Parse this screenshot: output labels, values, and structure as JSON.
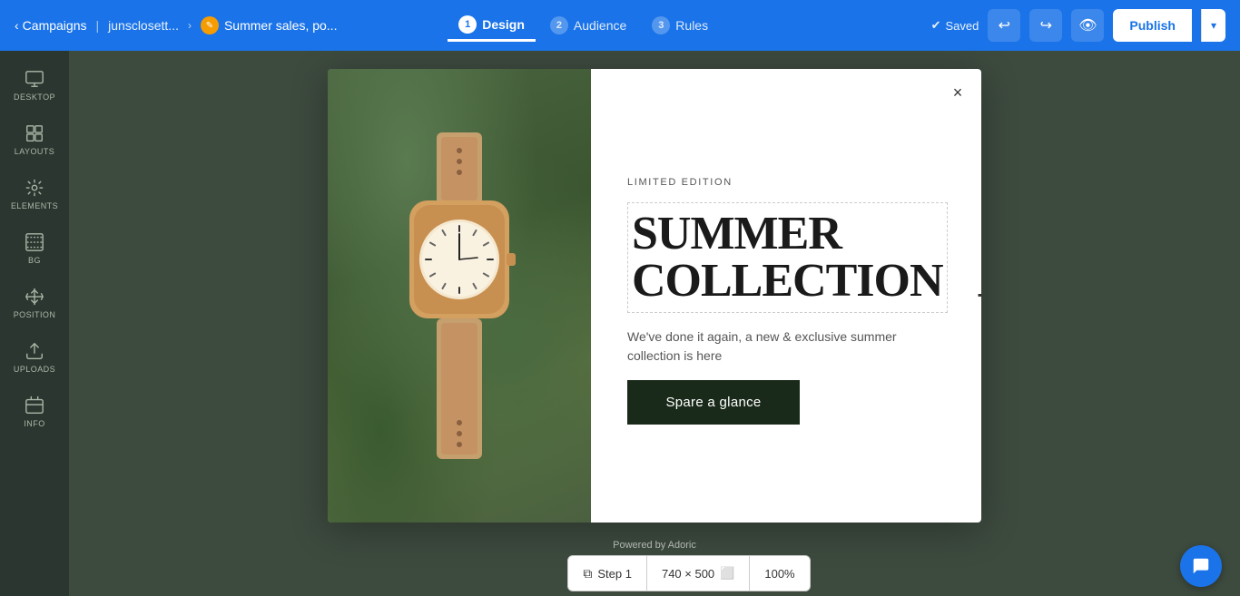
{
  "header": {
    "back_label": "Campaigns",
    "breadcrumb": "junsclosett...",
    "current_page": "Summer sales, po...",
    "steps": [
      {
        "num": "1",
        "label": "Design"
      },
      {
        "num": "2",
        "label": "Audience"
      },
      {
        "num": "3",
        "label": "Rules"
      }
    ],
    "saved_label": "Saved",
    "publish_label": "Publish"
  },
  "sidebar": {
    "items": [
      {
        "id": "desktop",
        "label": "DESKTOP"
      },
      {
        "id": "layouts",
        "label": "LAYOUTS"
      },
      {
        "id": "elements",
        "label": "ELEMENTS"
      },
      {
        "id": "bg",
        "label": "BG"
      },
      {
        "id": "position",
        "label": "POSITION"
      },
      {
        "id": "uploads",
        "label": "UPLOADS"
      },
      {
        "id": "info",
        "label": "INFO"
      }
    ]
  },
  "popup": {
    "eyebrow": "LIMITED EDITION",
    "title_line1": "SUMMER",
    "title_line2": "COLLECTION",
    "description": "We've done it again, a new & exclusive summer collection is here",
    "button_label": "Spare a glance",
    "close_label": "×"
  },
  "bottom": {
    "powered_by": "Powered by Adoric",
    "step_label": "Step 1",
    "dimensions": "740 × 500",
    "zoom": "100%"
  }
}
